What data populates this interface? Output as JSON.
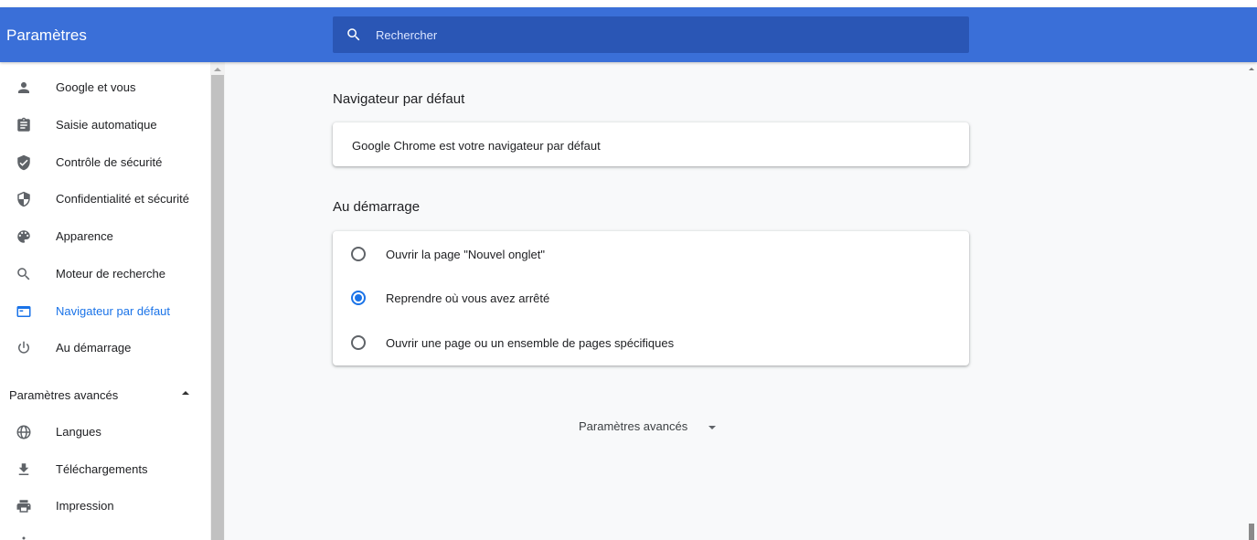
{
  "header": {
    "title": "Paramètres",
    "search_placeholder": "Rechercher",
    "color": "#3a6fd8"
  },
  "sidebar": {
    "items": [
      {
        "label": "Google et vous",
        "icon": "person-icon"
      },
      {
        "label": "Saisie automatique",
        "icon": "clipboard-icon"
      },
      {
        "label": "Contrôle de sécurité",
        "icon": "shield-check-icon"
      },
      {
        "label": "Confidentialité et sécurité",
        "icon": "shield-half-icon"
      },
      {
        "label": "Apparence",
        "icon": "palette-icon"
      },
      {
        "label": "Moteur de recherche",
        "icon": "search-icon"
      },
      {
        "label": "Navigateur par défaut",
        "icon": "browser-window-icon",
        "active": true
      },
      {
        "label": "Au démarrage",
        "icon": "power-icon"
      }
    ],
    "advanced_header": "Paramètres avancés",
    "advanced_items": [
      {
        "label": "Langues",
        "icon": "globe-icon"
      },
      {
        "label": "Téléchargements",
        "icon": "download-icon"
      },
      {
        "label": "Impression",
        "icon": "printer-icon"
      }
    ]
  },
  "main": {
    "default_browser": {
      "title": "Navigateur par défaut",
      "status": "Google Chrome est votre navigateur par défaut"
    },
    "startup": {
      "title": "Au démarrage",
      "options": [
        {
          "label": "Ouvrir la page \"Nouvel onglet\"",
          "checked": false
        },
        {
          "label": "Reprendre où vous avez arrêté",
          "checked": true
        },
        {
          "label": "Ouvrir une page ou un ensemble de pages spécifiques",
          "checked": false
        }
      ]
    },
    "advanced_button": "Paramètres avancés"
  },
  "colors": {
    "accent": "#1a73e8",
    "header": "#3a6fd8",
    "search_bg": "#2a56b5"
  }
}
